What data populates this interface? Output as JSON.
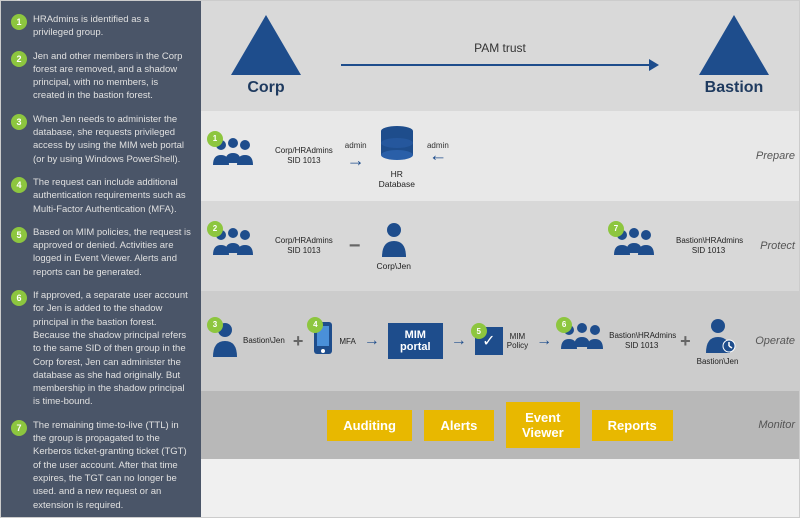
{
  "left_panel": {
    "steps": [
      {
        "num": "1",
        "text": "HRAdmins is identified as a privileged group."
      },
      {
        "num": "2",
        "text": "Jen and other members in the Corp forest are removed, and a shadow principal, with no members, is created in the bastion forest."
      },
      {
        "num": "3",
        "text": "When Jen needs to administer the database, she requests privileged access by using the MIM web portal (or by using Windows PowerShell)."
      },
      {
        "num": "4",
        "text": "The request can include additional authentication requirements such as Multi-Factor Authentication (MFA)."
      },
      {
        "num": "5",
        "text": "Based on MIM policies, the request is approved or denied. Activities are logged in Event Viewer. Alerts and reports can be generated."
      },
      {
        "num": "6",
        "text": "If approved, a separate user account for Jen is added to the shadow principal in the bastion forest. Because the shadow principal refers to the same SID of then group in the Corp forest, Jen can administer the database as she had originally. But membership in the shadow principal is time-bound."
      },
      {
        "num": "7",
        "text": "The remaining time-to-live (TTL) in the group is propagated to the Kerberos ticket-granting ticket (TGT) of the user account. After that time expires, the TGT can no longer be used. and a new request or an extension is required."
      }
    ]
  },
  "header": {
    "corp_label": "Corp",
    "bastion_label": "Bastion",
    "pam_trust": "PAM trust"
  },
  "sections": {
    "prepare": {
      "label": "Prepare",
      "step_num": "1",
      "admin_left": "admin",
      "admin_right": "admin",
      "group1_label": "Corp/HRAdmins\nSID 1013",
      "db_label": "HR\nDatabase",
      "arrow_direction": "→"
    },
    "protect": {
      "label": "Protect",
      "step_num": "2",
      "group1_label": "Corp/HRAdmins\nSID 1013",
      "person_label": "Corp\\Jen",
      "group2_label": "Bastion\\HRAdmins\nSID 1013",
      "badge_num": "7"
    },
    "operate": {
      "label": "Operate",
      "step_num": "3",
      "person1_label": "Bastion\\Jen",
      "step4_num": "4",
      "mfa_label": "MFA",
      "mim_label": "MIM\nportal",
      "step5_num": "5",
      "mim_policy_label": "MIM\nPolicy",
      "step6_num": "6",
      "group_label": "Bastion\\HRAdmins\nSID 1013",
      "person2_label": "Bastion\\Jen"
    },
    "monitor": {
      "label": "Monitor",
      "buttons": [
        {
          "label": "Auditing"
        },
        {
          "label": "Alerts"
        },
        {
          "label": "Event\nViewer"
        },
        {
          "label": "Reports"
        }
      ]
    }
  }
}
